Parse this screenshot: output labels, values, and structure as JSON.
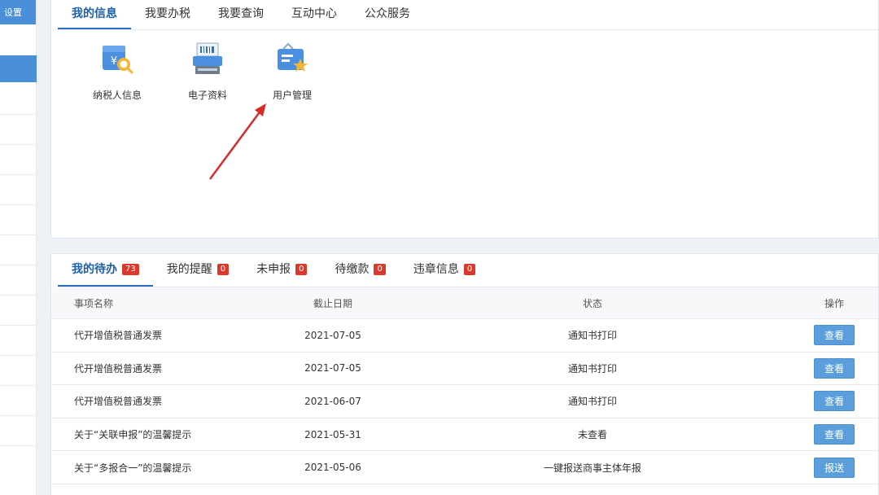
{
  "sidebar": {
    "top_label": "设置"
  },
  "top_tabs": [
    {
      "label": "我的信息",
      "active": true
    },
    {
      "label": "我要办税",
      "active": false
    },
    {
      "label": "我要查询",
      "active": false
    },
    {
      "label": "互动中心",
      "active": false
    },
    {
      "label": "公众服务",
      "active": false
    }
  ],
  "shortcuts": [
    {
      "label": "纳税人信息",
      "icon": "taxpayer-info-icon"
    },
    {
      "label": "电子资料",
      "icon": "electronic-documents-icon"
    },
    {
      "label": "用户管理",
      "icon": "user-management-icon"
    }
  ],
  "todo_tabs": [
    {
      "label": "我的待办",
      "count": "73",
      "active": true
    },
    {
      "label": "我的提醒",
      "count": "0",
      "active": false
    },
    {
      "label": "未申报",
      "count": "0",
      "active": false
    },
    {
      "label": "待缴款",
      "count": "0",
      "active": false
    },
    {
      "label": "违章信息",
      "count": "0",
      "active": false
    }
  ],
  "table": {
    "headers": [
      "事项名称",
      "截止日期",
      "状态",
      "操作"
    ],
    "rows": [
      {
        "name": "代开增值税普通发票",
        "date": "2021-07-05",
        "status": "通知书打印",
        "action": "查看"
      },
      {
        "name": "代开增值税普通发票",
        "date": "2021-07-05",
        "status": "通知书打印",
        "action": "查看"
      },
      {
        "name": "代开增值税普通发票",
        "date": "2021-06-07",
        "status": "通知书打印",
        "action": "查看"
      },
      {
        "name": "关于“关联申报”的温馨提示",
        "date": "2021-05-31",
        "status": "未查看",
        "action": "查看"
      },
      {
        "name": "关于“多报合一”的温馨提示",
        "date": "2021-05-06",
        "status": "一键报送商事主体年报",
        "action": "报送"
      }
    ]
  },
  "colors": {
    "accent": "#2a6fbf",
    "badge": "#d93a2b",
    "button": "#5a9fdc",
    "arrow": "#d62b2b"
  }
}
